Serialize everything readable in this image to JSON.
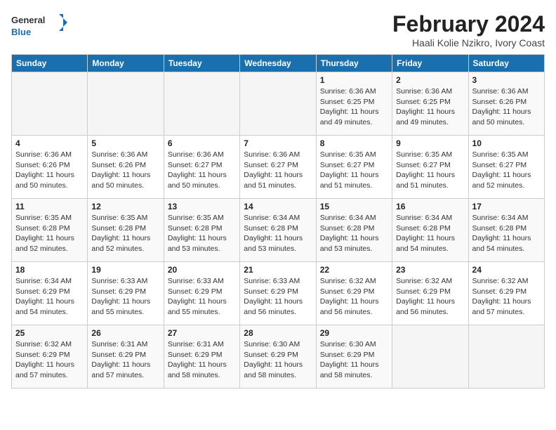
{
  "header": {
    "logo_line1": "General",
    "logo_line2": "Blue",
    "title": "February 2024",
    "subtitle": "Haali Kolie Nzikro, Ivory Coast"
  },
  "weekdays": [
    "Sunday",
    "Monday",
    "Tuesday",
    "Wednesday",
    "Thursday",
    "Friday",
    "Saturday"
  ],
  "weeks": [
    [
      {
        "day": "",
        "info": ""
      },
      {
        "day": "",
        "info": ""
      },
      {
        "day": "",
        "info": ""
      },
      {
        "day": "",
        "info": ""
      },
      {
        "day": "1",
        "info": "Sunrise: 6:36 AM\nSunset: 6:25 PM\nDaylight: 11 hours\nand 49 minutes."
      },
      {
        "day": "2",
        "info": "Sunrise: 6:36 AM\nSunset: 6:25 PM\nDaylight: 11 hours\nand 49 minutes."
      },
      {
        "day": "3",
        "info": "Sunrise: 6:36 AM\nSunset: 6:26 PM\nDaylight: 11 hours\nand 50 minutes."
      }
    ],
    [
      {
        "day": "4",
        "info": "Sunrise: 6:36 AM\nSunset: 6:26 PM\nDaylight: 11 hours\nand 50 minutes."
      },
      {
        "day": "5",
        "info": "Sunrise: 6:36 AM\nSunset: 6:26 PM\nDaylight: 11 hours\nand 50 minutes."
      },
      {
        "day": "6",
        "info": "Sunrise: 6:36 AM\nSunset: 6:27 PM\nDaylight: 11 hours\nand 50 minutes."
      },
      {
        "day": "7",
        "info": "Sunrise: 6:36 AM\nSunset: 6:27 PM\nDaylight: 11 hours\nand 51 minutes."
      },
      {
        "day": "8",
        "info": "Sunrise: 6:35 AM\nSunset: 6:27 PM\nDaylight: 11 hours\nand 51 minutes."
      },
      {
        "day": "9",
        "info": "Sunrise: 6:35 AM\nSunset: 6:27 PM\nDaylight: 11 hours\nand 51 minutes."
      },
      {
        "day": "10",
        "info": "Sunrise: 6:35 AM\nSunset: 6:27 PM\nDaylight: 11 hours\nand 52 minutes."
      }
    ],
    [
      {
        "day": "11",
        "info": "Sunrise: 6:35 AM\nSunset: 6:28 PM\nDaylight: 11 hours\nand 52 minutes."
      },
      {
        "day": "12",
        "info": "Sunrise: 6:35 AM\nSunset: 6:28 PM\nDaylight: 11 hours\nand 52 minutes."
      },
      {
        "day": "13",
        "info": "Sunrise: 6:35 AM\nSunset: 6:28 PM\nDaylight: 11 hours\nand 53 minutes."
      },
      {
        "day": "14",
        "info": "Sunrise: 6:34 AM\nSunset: 6:28 PM\nDaylight: 11 hours\nand 53 minutes."
      },
      {
        "day": "15",
        "info": "Sunrise: 6:34 AM\nSunset: 6:28 PM\nDaylight: 11 hours\nand 53 minutes."
      },
      {
        "day": "16",
        "info": "Sunrise: 6:34 AM\nSunset: 6:28 PM\nDaylight: 11 hours\nand 54 minutes."
      },
      {
        "day": "17",
        "info": "Sunrise: 6:34 AM\nSunset: 6:28 PM\nDaylight: 11 hours\nand 54 minutes."
      }
    ],
    [
      {
        "day": "18",
        "info": "Sunrise: 6:34 AM\nSunset: 6:29 PM\nDaylight: 11 hours\nand 54 minutes."
      },
      {
        "day": "19",
        "info": "Sunrise: 6:33 AM\nSunset: 6:29 PM\nDaylight: 11 hours\nand 55 minutes."
      },
      {
        "day": "20",
        "info": "Sunrise: 6:33 AM\nSunset: 6:29 PM\nDaylight: 11 hours\nand 55 minutes."
      },
      {
        "day": "21",
        "info": "Sunrise: 6:33 AM\nSunset: 6:29 PM\nDaylight: 11 hours\nand 56 minutes."
      },
      {
        "day": "22",
        "info": "Sunrise: 6:32 AM\nSunset: 6:29 PM\nDaylight: 11 hours\nand 56 minutes."
      },
      {
        "day": "23",
        "info": "Sunrise: 6:32 AM\nSunset: 6:29 PM\nDaylight: 11 hours\nand 56 minutes."
      },
      {
        "day": "24",
        "info": "Sunrise: 6:32 AM\nSunset: 6:29 PM\nDaylight: 11 hours\nand 57 minutes."
      }
    ],
    [
      {
        "day": "25",
        "info": "Sunrise: 6:32 AM\nSunset: 6:29 PM\nDaylight: 11 hours\nand 57 minutes."
      },
      {
        "day": "26",
        "info": "Sunrise: 6:31 AM\nSunset: 6:29 PM\nDaylight: 11 hours\nand 57 minutes."
      },
      {
        "day": "27",
        "info": "Sunrise: 6:31 AM\nSunset: 6:29 PM\nDaylight: 11 hours\nand 58 minutes."
      },
      {
        "day": "28",
        "info": "Sunrise: 6:30 AM\nSunset: 6:29 PM\nDaylight: 11 hours\nand 58 minutes."
      },
      {
        "day": "29",
        "info": "Sunrise: 6:30 AM\nSunset: 6:29 PM\nDaylight: 11 hours\nand 58 minutes."
      },
      {
        "day": "",
        "info": ""
      },
      {
        "day": "",
        "info": ""
      }
    ]
  ]
}
